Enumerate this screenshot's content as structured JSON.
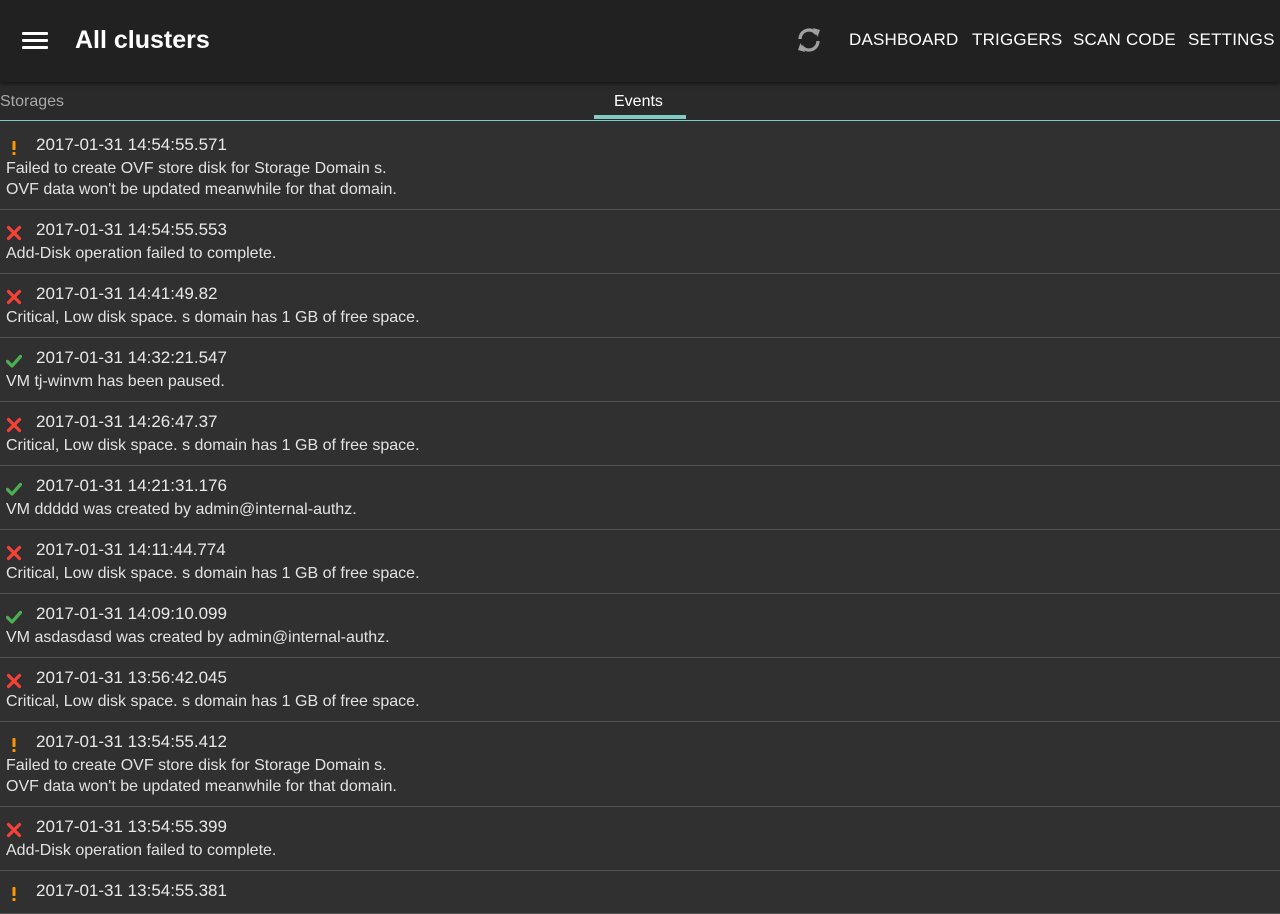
{
  "header": {
    "title": "All clusters",
    "actions": [
      "DASHBOARD",
      "TRIGGERS",
      "SCAN CODE",
      "SETTINGS"
    ]
  },
  "icons": {
    "menu": "menu-icon",
    "refresh": "refresh-icon",
    "warning": "warning-icon",
    "error": "error-icon",
    "success": "check-icon"
  },
  "colors": {
    "accent": "#80cbc4",
    "error": "#f44336",
    "success": "#4caf50",
    "warning": "#ff9800"
  },
  "tabs": [
    {
      "label": "Storages",
      "selected": false
    },
    {
      "label": "Events",
      "selected": true
    }
  ],
  "events": [
    {
      "severity": "warning",
      "time": "2017-01-31 14:54:55.571",
      "message": "Failed to create OVF store disk for Storage Domain s.\n OVF data won't be updated meanwhile for that domain."
    },
    {
      "severity": "error",
      "time": "2017-01-31 14:54:55.553",
      "message": "Add-Disk operation failed to complete."
    },
    {
      "severity": "error",
      "time": "2017-01-31 14:41:49.82",
      "message": "Critical, Low disk space. s domain has 1 GB of free space."
    },
    {
      "severity": "success",
      "time": "2017-01-31 14:32:21.547",
      "message": "VM tj-winvm has been paused."
    },
    {
      "severity": "error",
      "time": "2017-01-31 14:26:47.37",
      "message": "Critical, Low disk space. s domain has 1 GB of free space."
    },
    {
      "severity": "success",
      "time": "2017-01-31 14:21:31.176",
      "message": "VM ddddd was created by admin@internal-authz."
    },
    {
      "severity": "error",
      "time": "2017-01-31 14:11:44.774",
      "message": "Critical, Low disk space. s domain has 1 GB of free space."
    },
    {
      "severity": "success",
      "time": "2017-01-31 14:09:10.099",
      "message": "VM asdasdasd was created by admin@internal-authz."
    },
    {
      "severity": "error",
      "time": "2017-01-31 13:56:42.045",
      "message": "Critical, Low disk space. s domain has 1 GB of free space."
    },
    {
      "severity": "warning",
      "time": "2017-01-31 13:54:55.412",
      "message": "Failed to create OVF store disk for Storage Domain s.\n OVF data won't be updated meanwhile for that domain."
    },
    {
      "severity": "error",
      "time": "2017-01-31 13:54:55.399",
      "message": "Add-Disk operation failed to complete."
    },
    {
      "severity": "warning",
      "time": "2017-01-31 13:54:55.381",
      "message": ""
    }
  ]
}
